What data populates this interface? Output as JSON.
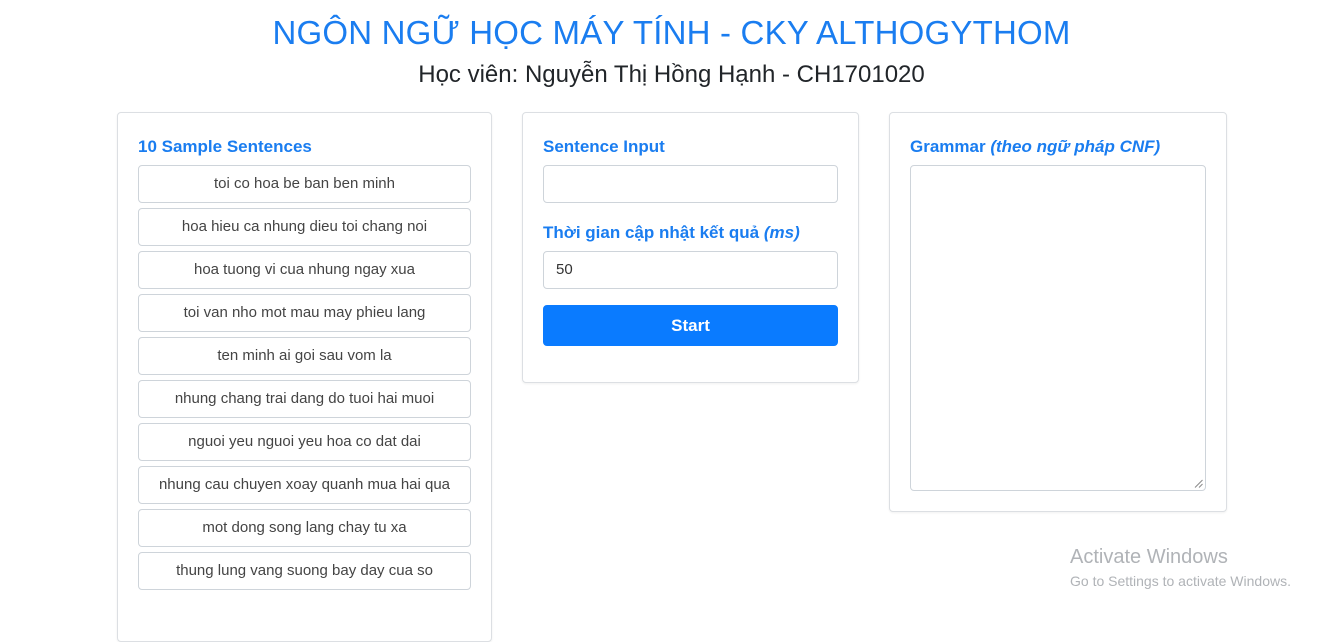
{
  "header": {
    "title": "NGÔN NGỮ HỌC MÁY TÍNH - CKY ALTHOGYTHOM",
    "subtitle": "Học viên: Nguyễn Thị Hồng Hạnh - CH1701020"
  },
  "samples": {
    "heading": "10 Sample Sentences",
    "items": [
      "toi co hoa be ban ben minh",
      "hoa hieu ca nhung dieu toi chang noi",
      "hoa tuong vi cua nhung ngay xua",
      "toi van nho mot mau may phieu lang",
      "ten minh ai goi sau vom la",
      "nhung chang trai dang do tuoi hai muoi",
      "nguoi yeu nguoi yeu hoa co dat dai",
      "nhung cau chuyen xoay quanh mua hai qua",
      "mot dong song lang chay tu xa",
      "thung lung vang suong bay day cua so"
    ]
  },
  "input_panel": {
    "sentence_label": "Sentence Input",
    "sentence_value": "",
    "interval_label": "Thời gian cập nhật kết quả",
    "interval_unit": "(ms)",
    "interval_value": "50",
    "start_label": "Start"
  },
  "grammar_panel": {
    "label": "Grammar",
    "label_note": "(theo ngữ pháp CNF)",
    "value": ""
  },
  "watermark": {
    "line1": "Activate Windows",
    "line2": "Go to Settings to activate Windows."
  },
  "colors": {
    "accent": "#1a7df0",
    "button": "#0a7bff"
  }
}
